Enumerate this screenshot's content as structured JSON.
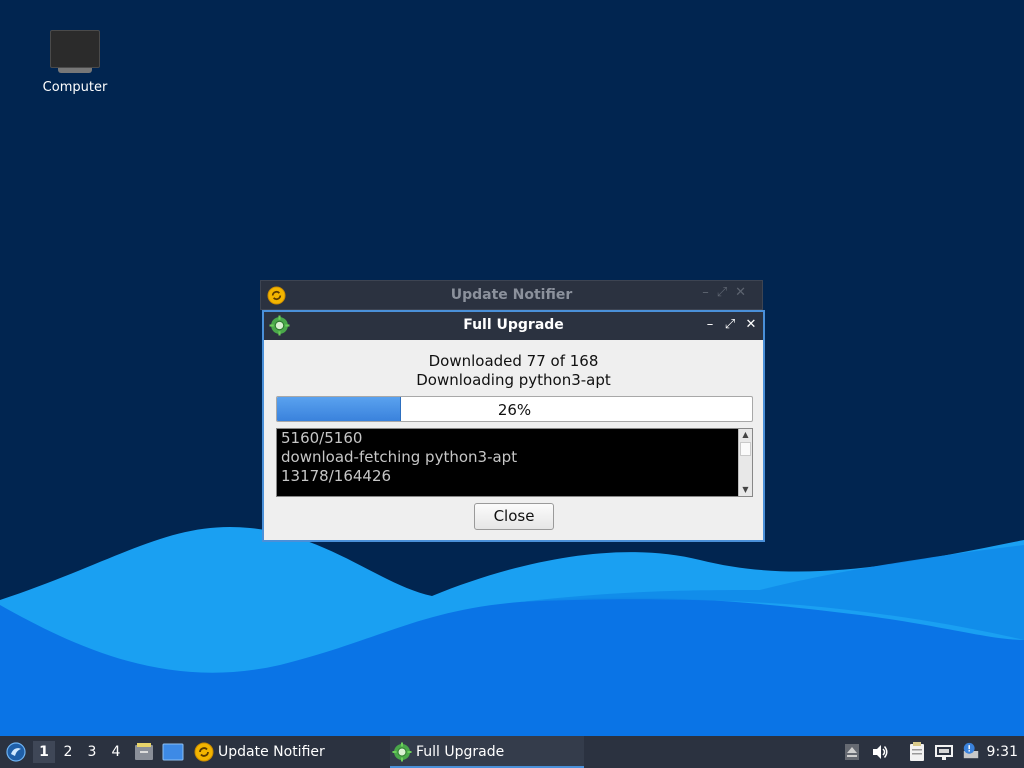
{
  "desktop": {
    "icons": [
      {
        "label": "Computer",
        "icon": "computer-icon"
      }
    ]
  },
  "background_window": {
    "title": "Update Notifier",
    "icon": "update-notifier-icon",
    "controls": [
      "minimize",
      "maximize",
      "close"
    ]
  },
  "dialog": {
    "title": "Full Upgrade",
    "icon": "gear-icon",
    "status_line1": "Downloaded 77 of 168",
    "status_line2": "Downloading python3-apt",
    "progress": {
      "value": 0.26,
      "label": "26%"
    },
    "log_lines": [
      "5160/5160",
      "download-fetching python3-apt",
      "13178/164426"
    ],
    "close_label": "Close",
    "controls": {
      "minimize": "–",
      "maximize": "⤢",
      "close": "✕"
    }
  },
  "taskbar": {
    "menu_icon": "lubuntu-menu-icon",
    "workspaces": [
      "1",
      "2",
      "3",
      "4"
    ],
    "active_workspace": "1",
    "quicklaunch": [
      "file-manager-icon",
      "show-desktop-icon"
    ],
    "tasks": [
      {
        "label": "Update Notifier",
        "icon": "update-notifier-icon",
        "active": false
      },
      {
        "label": "Full Upgrade",
        "icon": "gear-icon",
        "active": true
      }
    ],
    "tray": [
      "eject-icon",
      "volume-icon",
      "clipboard-icon",
      "network-icon",
      "update-alert-icon"
    ],
    "clock": "9:31"
  },
  "colors": {
    "desktop_bg": "#012550",
    "wave_light": "#1aa0f2",
    "wave_dark": "#0a6ee0",
    "titlebar": "#2b3240",
    "accent": "#4a90d9",
    "progress_fill": "#3a82dc"
  }
}
